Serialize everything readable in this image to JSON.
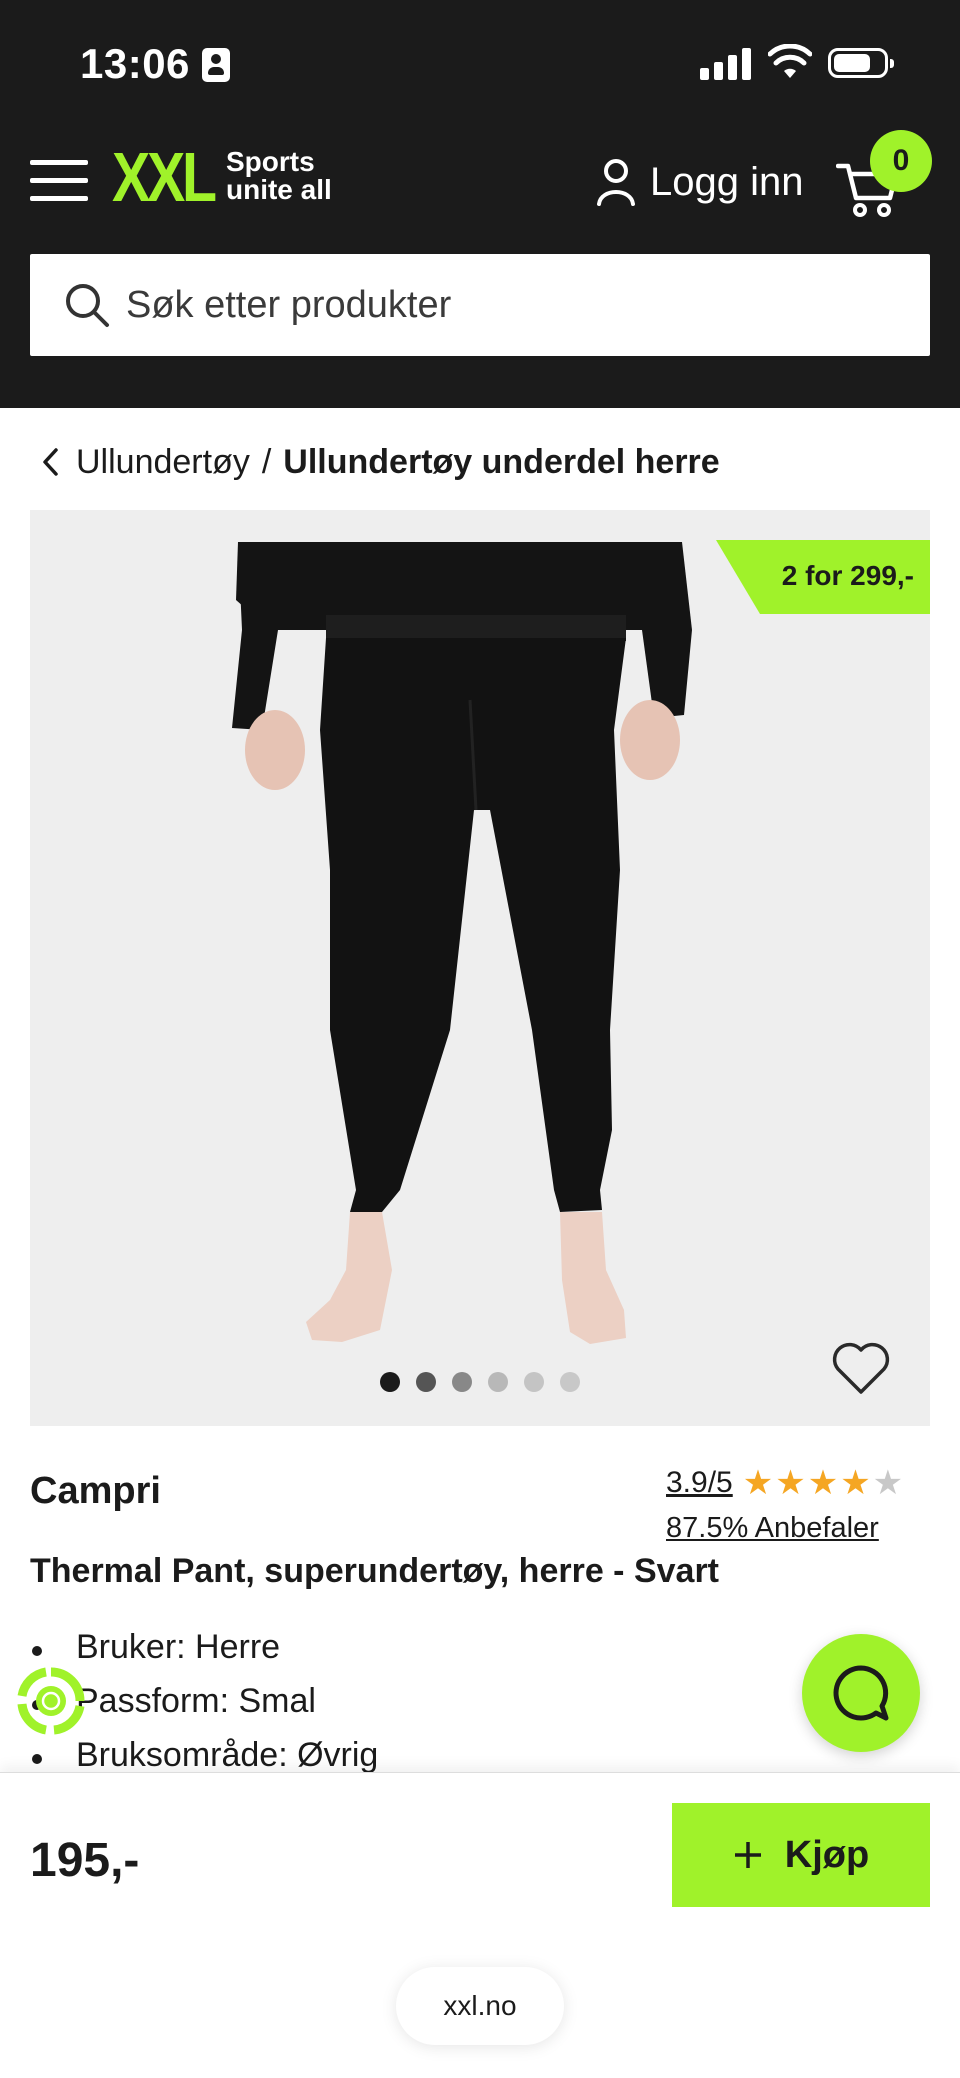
{
  "status_bar": {
    "time": "13:06"
  },
  "header": {
    "logo_text": "XXL",
    "logo_tagline_line1": "Sports",
    "logo_tagline_line2": "unite all",
    "login_label": "Logg inn",
    "cart_count": "0",
    "search_placeholder": "Søk etter produkter"
  },
  "breadcrumb": {
    "parent": "Ullundertøy",
    "separator": "/",
    "current": "Ullundertøy underdel herre"
  },
  "product": {
    "promo_badge": "2 for 299,-",
    "image_count": 6,
    "active_image": 1,
    "brand": "Campri",
    "rating": "3.9/5",
    "rating_value": 3.9,
    "rating_max": 5,
    "recommend": "87.5% Anbefaler",
    "title": "Thermal Pant, superundertøy, herre - Svart",
    "specs": [
      "Bruker: Herre",
      "Passform: Smal",
      "Bruksområde: Øvrig"
    ],
    "price": "195,-",
    "buy_label": "Kjøp"
  },
  "browser": {
    "url": "xxl.no"
  },
  "colors": {
    "brand_green": "#a0f22a",
    "header_bg": "#1b1b1b",
    "star_filled": "#f5a623",
    "star_empty": "#c8c8c8"
  },
  "icons": [
    "id-card-icon",
    "signal-icon",
    "wifi-icon",
    "battery-icon",
    "menu-icon",
    "user-icon",
    "cart-icon",
    "search-icon",
    "chevron-left-icon",
    "heart-icon",
    "star-icon",
    "chat-icon",
    "loyalty-icon",
    "plus-icon"
  ]
}
